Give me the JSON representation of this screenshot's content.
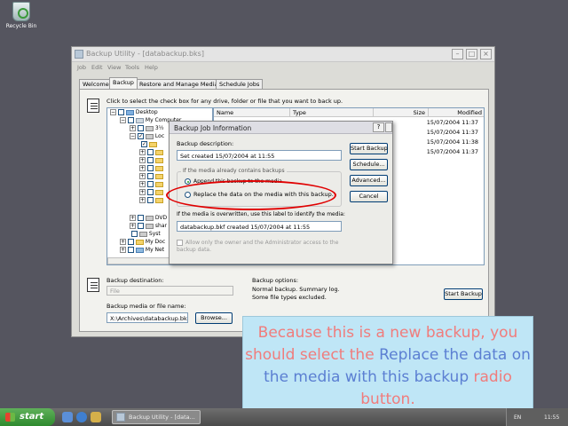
{
  "desktop": {
    "recycle_bin_label": "Recycle Bin"
  },
  "window": {
    "title": "Backup Utility - [databackup.bks]",
    "menu": [
      "Job",
      "Edit",
      "View",
      "Tools",
      "Help"
    ],
    "tabs": [
      "Welcome",
      "Backup",
      "Restore and Manage Media",
      "Schedule Jobs"
    ],
    "active_tab": "Backup",
    "hint": "Click to select the check box for any drive, folder or file that you want to back up.",
    "tree": [
      "Desktop",
      "My Computer",
      "3½",
      "Loc",
      "DVD",
      "shar",
      "Syst",
      "My Doc",
      "My Net"
    ],
    "columns": [
      "Name",
      "Type",
      "Size",
      "Modified"
    ],
    "modified_values": [
      "15/07/2004 11:37",
      "15/07/2004 11:37",
      "15/07/2004 11:38",
      "15/07/2004 11:37"
    ],
    "destination_label": "Backup destination:",
    "destination_value": "File",
    "media_label": "Backup media or file name:",
    "media_value": "X:\\Archives\\databackup.bkf",
    "browse_label": "Browse...",
    "options_title": "Backup options:",
    "options_lines": [
      "Normal backup.  Summary log.",
      "Some file types excluded."
    ],
    "start_label": "Start Backup"
  },
  "dialog": {
    "title": "Backup Job Information",
    "description_label": "Backup description:",
    "description_value": "Set created 15/07/2004 at 11:55",
    "group_label": "If the media already contains backups",
    "option_append": "Append this backup to the media.",
    "option_replace": "Replace the data on the media with this backup.",
    "overwrite_label": "If the media is overwritten, use this label to identify the media:",
    "overwrite_value": "databackup.bkf created 15/07/2004 at 11:55",
    "allow_only": "Allow only the owner and the Administrator access to the backup data.",
    "buttons": [
      "Start Backup",
      "Schedule...",
      "Advanced...",
      "Cancel"
    ]
  },
  "callout": {
    "part1": "Because this is a new backup, you should select the ",
    "highlight1": "Replace the data on the media with this backup",
    "part2": " radio button."
  },
  "taskbar": {
    "start_label": "start",
    "task_label": "Backup Utility - [data...",
    "lang": "EN",
    "clock": "11:55"
  },
  "colors": {
    "desktop": "#55555f",
    "callout_bg": "#bfe6f6",
    "callout_text": "#f07c7c",
    "callout_highlight": "#5b7fd2",
    "red_ring": "#e00000"
  }
}
